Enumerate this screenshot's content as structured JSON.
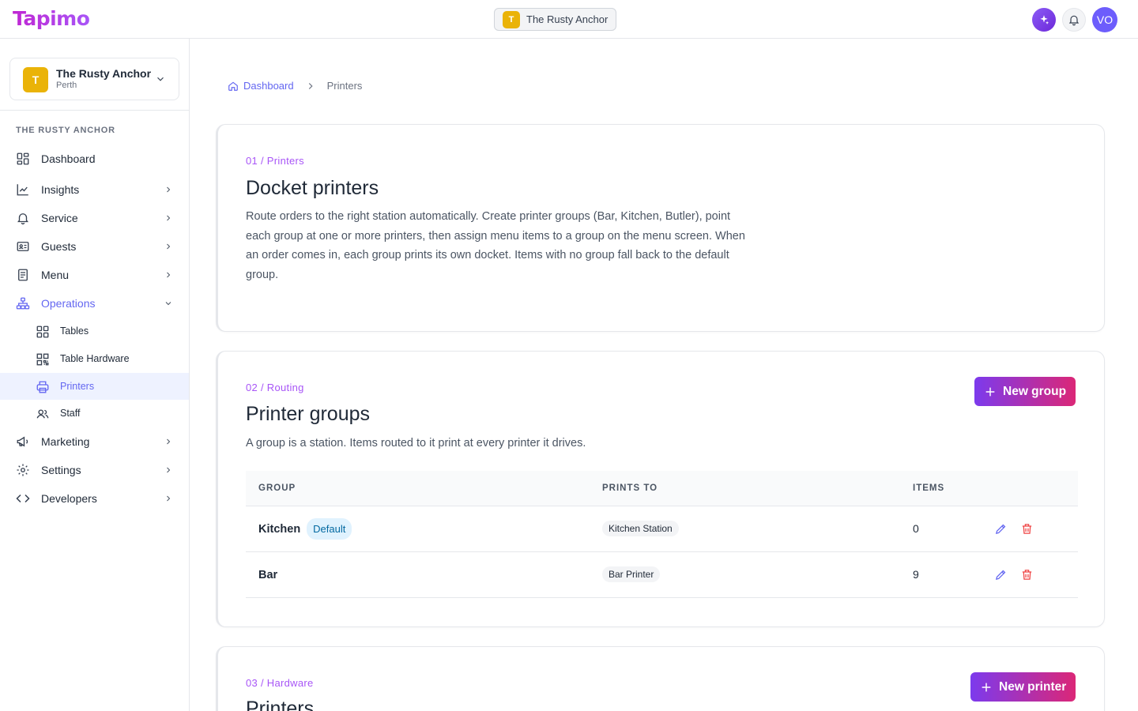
{
  "app": {
    "logo": "Tapimo",
    "venue_pill": {
      "initial": "T",
      "name": "The Rusty Anchor"
    },
    "avatar_initials": "VO",
    "colors": {
      "accent": "#6366f1",
      "brand": "#a855f7",
      "venue": "#eab308",
      "danger": "#ef4444"
    }
  },
  "sidebar": {
    "venue_card": {
      "initial": "T",
      "name": "The Rusty Anchor",
      "location": "Perth"
    },
    "section_label": "THE RUSTY ANCHOR",
    "items": [
      {
        "label": "Dashboard",
        "icon": "grid-icon"
      },
      {
        "label": "Insights",
        "icon": "chart-line-icon"
      },
      {
        "label": "Service",
        "icon": "bell-icon"
      },
      {
        "label": "Guests",
        "icon": "id-card-icon"
      },
      {
        "label": "Menu",
        "icon": "document-icon"
      },
      {
        "label": "Operations",
        "icon": "hierarchy-icon"
      },
      {
        "label": "Marketing",
        "icon": "megaphone-icon"
      },
      {
        "label": "Settings",
        "icon": "gear-icon"
      },
      {
        "label": "Developers",
        "icon": "code-icon"
      }
    ],
    "operations_children": [
      {
        "label": "Tables",
        "icon": "tables-icon"
      },
      {
        "label": "Table Hardware",
        "icon": "qr-code-icon"
      },
      {
        "label": "Printers",
        "icon": "printer-icon"
      },
      {
        "label": "Staff",
        "icon": "users-icon"
      }
    ]
  },
  "breadcrumb": {
    "home": "Dashboard",
    "current": "Printers"
  },
  "cards": {
    "docket": {
      "eyebrow": "01 / Printers",
      "title": "Docket printers",
      "desc_lines": [
        "Route orders to the right station automatically. Create printer groups (Bar, Kitchen, Butler), point",
        "each group at one or more printers, then assign menu items to a group on the menu screen. When",
        "an order comes in, each group prints its own docket. Items with no group fall back to the default",
        "group."
      ]
    },
    "groups": {
      "eyebrow": "02 / Routing",
      "title": "Printer groups",
      "desc": "A group is a station. Items routed to it print at every printer it drives.",
      "button": "New group",
      "columns": [
        "GROUP",
        "PRINTS TO",
        "ITEMS"
      ],
      "rows": [
        {
          "group": "Kitchen",
          "badge": "Default",
          "prints_to": "Kitchen Station",
          "items": "0"
        },
        {
          "group": "Bar",
          "badge": "",
          "prints_to": "Bar Printer",
          "items": "9"
        }
      ]
    },
    "hardware": {
      "eyebrow": "03 / Hardware",
      "title": "Printers",
      "button": "New printer"
    }
  }
}
